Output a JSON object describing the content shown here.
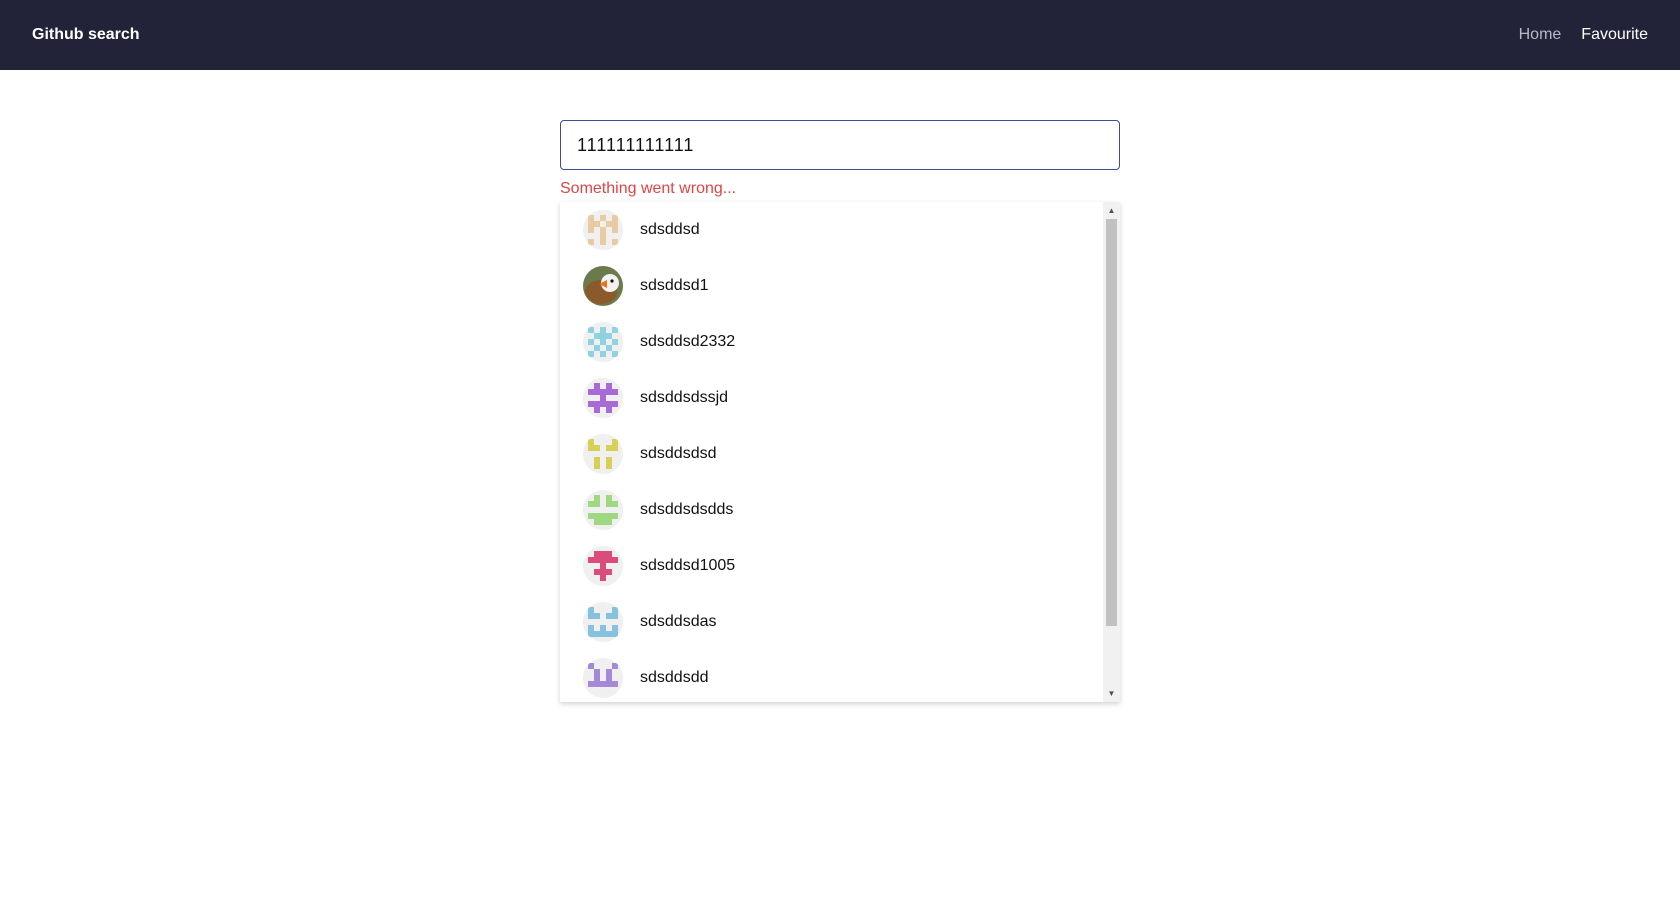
{
  "navbar": {
    "brand": "Github search",
    "links": [
      {
        "label": "Home",
        "active": false
      },
      {
        "label": "Favourite",
        "active": true
      }
    ]
  },
  "search": {
    "value": "111111111111",
    "placeholder": ""
  },
  "error": "Something went wrong...",
  "results": [
    {
      "login": "sdsddsd",
      "avatar": "identicon",
      "color": "#e8cba3",
      "pattern": [
        1,
        0,
        1,
        0,
        1,
        1,
        1,
        0,
        1,
        1,
        1,
        0,
        1,
        0,
        1,
        0,
        0,
        1,
        0,
        0,
        1,
        0,
        1,
        0,
        1
      ]
    },
    {
      "login": "sdsddsd1",
      "avatar": "photo-icon",
      "color": "#8a5a2b",
      "pattern": []
    },
    {
      "login": "sdsddsd2332",
      "avatar": "identicon",
      "color": "#8fd3e2",
      "pattern": [
        1,
        0,
        1,
        0,
        1,
        0,
        1,
        1,
        1,
        0,
        1,
        0,
        1,
        0,
        1,
        0,
        1,
        0,
        1,
        0,
        1,
        0,
        1,
        0,
        1
      ]
    },
    {
      "login": "sdsddsdssjd",
      "avatar": "identicon",
      "color": "#a86bd6",
      "pattern": [
        0,
        1,
        0,
        1,
        0,
        1,
        1,
        1,
        1,
        1,
        0,
        0,
        1,
        0,
        0,
        1,
        1,
        1,
        1,
        1,
        0,
        1,
        0,
        1,
        0
      ]
    },
    {
      "login": "sdsddsdsd",
      "avatar": "identicon",
      "color": "#d8cf57",
      "pattern": [
        1,
        0,
        0,
        0,
        1,
        1,
        1,
        0,
        1,
        1,
        0,
        0,
        0,
        0,
        0,
        0,
        1,
        0,
        1,
        0,
        0,
        1,
        0,
        1,
        0
      ]
    },
    {
      "login": "sdsddsdsdds",
      "avatar": "identicon",
      "color": "#9fd880",
      "pattern": [
        0,
        1,
        0,
        1,
        0,
        1,
        1,
        0,
        1,
        1,
        0,
        0,
        0,
        0,
        0,
        1,
        1,
        1,
        1,
        1,
        0,
        1,
        1,
        1,
        0
      ]
    },
    {
      "login": "sdsddsd1005",
      "avatar": "identicon",
      "color": "#d94c7b",
      "pattern": [
        0,
        1,
        1,
        1,
        0,
        1,
        1,
        1,
        1,
        1,
        0,
        0,
        1,
        0,
        0,
        0,
        1,
        1,
        1,
        0,
        0,
        0,
        1,
        0,
        0
      ]
    },
    {
      "login": "sdsddsdas",
      "avatar": "identicon",
      "color": "#86c2dd",
      "pattern": [
        1,
        0,
        0,
        0,
        1,
        1,
        1,
        0,
        1,
        1,
        0,
        0,
        0,
        0,
        0,
        1,
        0,
        1,
        0,
        1,
        1,
        1,
        1,
        1,
        1
      ]
    },
    {
      "login": "sdsddsdd",
      "avatar": "identicon",
      "color": "#a688d8",
      "pattern": [
        1,
        0,
        0,
        0,
        1,
        0,
        1,
        0,
        1,
        0,
        0,
        1,
        0,
        1,
        0,
        1,
        1,
        1,
        1,
        1,
        0,
        0,
        0,
        0,
        0
      ]
    }
  ],
  "scrollbar": {
    "position": 0.0,
    "visible_fraction": 0.85
  }
}
